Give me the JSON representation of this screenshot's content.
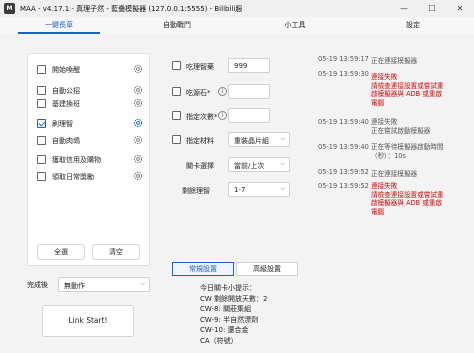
{
  "window": {
    "title": "MAA - v4.17.1 - 真理子然 - 藍疊模擬器 (127.0.0.1:5555) - Bilibili服",
    "app_icon_text": "M",
    "minimize": "—",
    "maximize": "☐",
    "close": "✕"
  },
  "tabs": [
    {
      "label": "一鍵長草",
      "active": true
    },
    {
      "label": "自動戰鬥",
      "active": false
    },
    {
      "label": "小工具",
      "active": false
    },
    {
      "label": "設定",
      "active": false
    }
  ],
  "tasks": [
    {
      "label": "開始喚醒",
      "checked": false
    },
    {
      "label": "自動公招",
      "checked": false
    },
    {
      "label": "基建換班",
      "checked": false
    },
    {
      "label": "刷理智",
      "checked": true
    },
    {
      "label": "自動肉鴿",
      "checked": false
    },
    {
      "label": "獲取信用及購物",
      "checked": false
    },
    {
      "label": "領取日常獎勵",
      "checked": false
    }
  ],
  "buttons": {
    "select_all": "全選",
    "clear": "清空",
    "link_start": "Link Start!"
  },
  "after_complete": {
    "label": "完成後",
    "value": "無動作"
  },
  "options": {
    "use_sanity_potion": {
      "label": "吃理智藥",
      "value": "999",
      "checked": false
    },
    "use_originium": {
      "label": "吃源石*",
      "checked": false
    },
    "specify_times": {
      "label": "指定次數*",
      "checked": false
    },
    "specify_material": {
      "label": "指定材料",
      "value": "重裝晶片組",
      "checked": false
    },
    "stage_select": {
      "label": "關卡選擇",
      "value": "當前/上次"
    },
    "stage_refresh": {
      "label": "剩餘理智",
      "value": "1-7"
    }
  },
  "settings_tabs": [
    {
      "label": "常規設置",
      "active": true
    },
    {
      "label": "高級設置",
      "active": false
    }
  ],
  "tips": [
    "今日關卡小提示：",
    "CW 剩餘開放天數：2",
    "CW-8: 關莊集組",
    "CW-9: 半自然漂劑",
    "CW-10: 還合金",
    "CA（符號）"
  ],
  "log": [
    {
      "time": "05-19  13:59:17",
      "message": [
        "正在連接模擬器"
      ],
      "color": "gray"
    },
    {
      "time": "05-19  13:59:30",
      "message": [
        "",
        "連接失敗",
        "請檢查連接設置或嘗試重",
        "啟模擬器與 ADB 或重啟",
        "電腦"
      ],
      "color": "red"
    },
    {
      "time": "05-19  13:59:40",
      "message": [
        "連接失敗",
        "正在嘗試啟動模擬器"
      ],
      "color": "gray"
    },
    {
      "time": "05-19  13:59:40",
      "message": [
        "正在等待模擬器啟動時間",
        "（秒）：10s"
      ],
      "color": "gray"
    },
    {
      "time": "05-19  13:59:52",
      "message": [
        "正在連接模擬器"
      ],
      "color": "gray"
    },
    {
      "time": "05-19  13:59:52",
      "message": [
        "連接失敗",
        "請檢查連接設置或嘗試重",
        "啟模擬器與 ADB 或重啟",
        "電腦"
      ],
      "color": "red"
    }
  ]
}
